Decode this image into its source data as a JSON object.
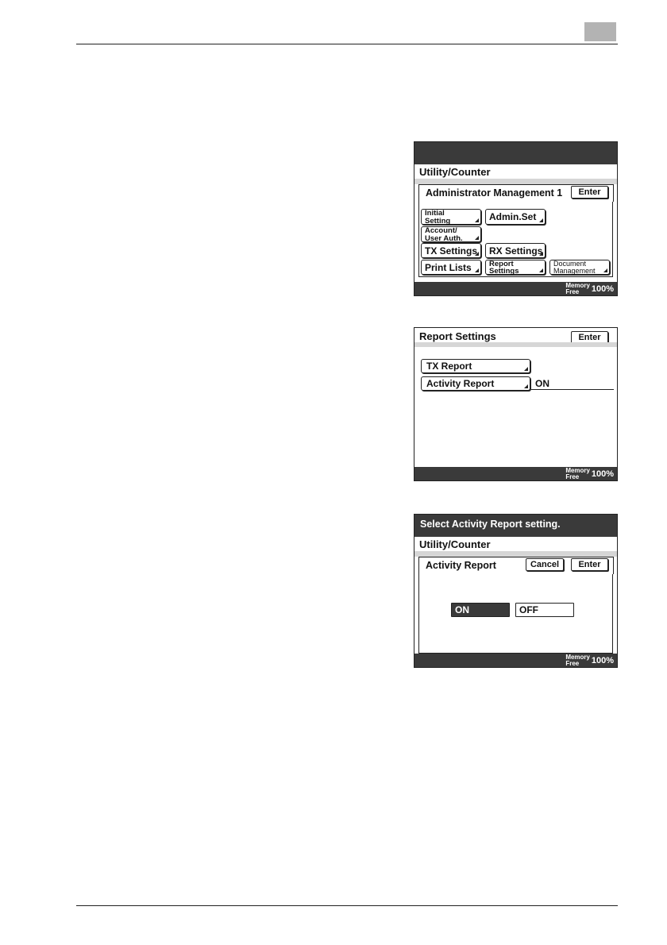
{
  "screen1": {
    "title": "Utility/Counter",
    "tab": "Administrator Management 1",
    "enter": "Enter",
    "buttons": {
      "initial_setting": [
        "Initial",
        "Setting"
      ],
      "admin_set": "Admin.Set",
      "account_user_auth": [
        "Account/",
        "User Auth."
      ],
      "tx_settings": "TX Settings",
      "rx_settings": "RX Settings",
      "print_lists": "Print Lists",
      "report_settings": [
        "Report",
        "Settings"
      ],
      "document_management": [
        "Document",
        "Management"
      ]
    },
    "memory_label": [
      "Memory",
      "Free"
    ],
    "memory_value": "100%"
  },
  "screen2": {
    "title": "Report Settings",
    "enter": "Enter",
    "tx_report": "TX Report",
    "activity_report": "Activity Report",
    "activity_value": "ON",
    "memory_label": [
      "Memory",
      "Free"
    ],
    "memory_value": "100%"
  },
  "screen3": {
    "message": "Select Activity Report setting.",
    "title": "Utility/Counter",
    "tab": "Activity Report",
    "cancel": "Cancel",
    "enter": "Enter",
    "on": "ON",
    "off": "OFF",
    "selected": "ON",
    "memory_label": [
      "Memory",
      "Free"
    ],
    "memory_value": "100%"
  }
}
